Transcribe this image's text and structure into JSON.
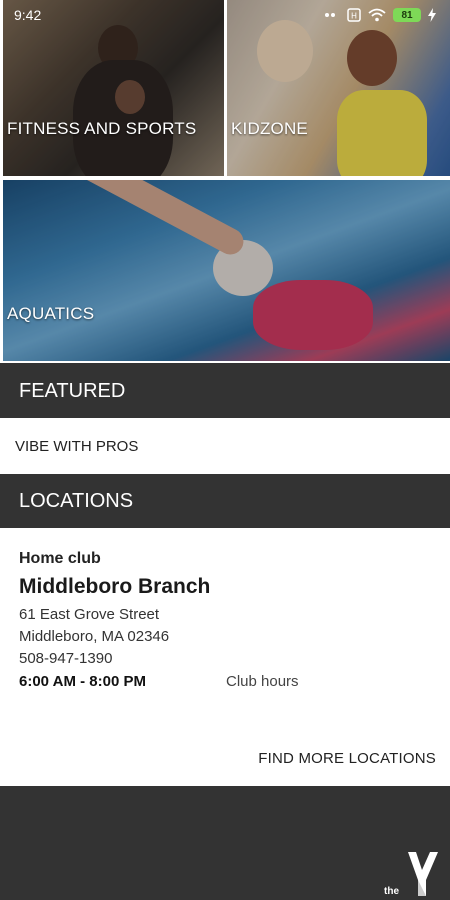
{
  "status_bar": {
    "time": "9:42",
    "battery": "81"
  },
  "tiles": {
    "fitness": "FITNESS AND SPORTS",
    "kidzone": "KIDZONE",
    "aquatics": "AQUATICS"
  },
  "featured": {
    "header": "FEATURED",
    "items": [
      "VIBE WITH PROS"
    ]
  },
  "locations": {
    "header": "LOCATIONS",
    "home_club_label": "Home club",
    "branch_name": "Middleboro Branch",
    "address_line1": "61 East Grove Street",
    "address_line2": "Middleboro, MA 02346",
    "phone": "508-947-1390",
    "hours": "6:00 AM - 8:00 PM",
    "club_hours_link": "Club hours",
    "find_more": "FIND MORE LOCATIONS"
  },
  "footer": {
    "logo_text": "the"
  },
  "colors": {
    "header_bg": "#333333",
    "card_bg": "#ffffff",
    "battery": "#7ed957"
  }
}
